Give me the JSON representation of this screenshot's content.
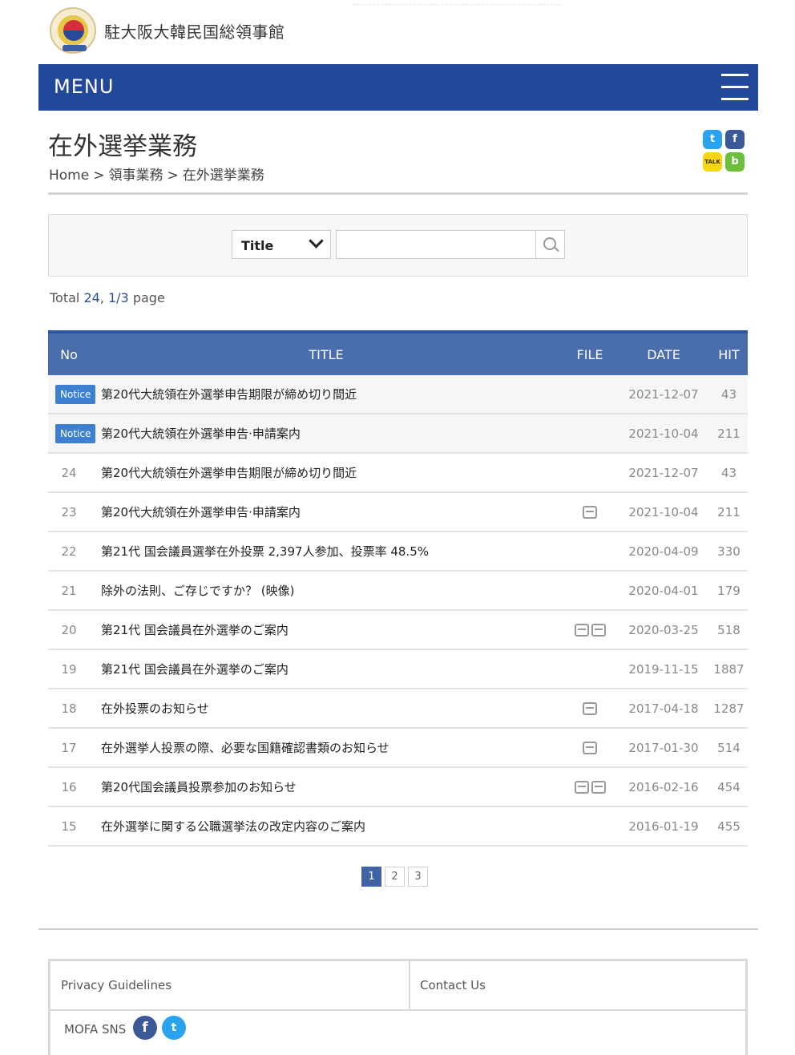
{
  "site": {
    "name": "駐大阪大韓民国総領事館"
  },
  "menu": {
    "label": "MENU"
  },
  "page": {
    "title": "在外選挙業務",
    "breadcrumb": [
      "Home",
      ">",
      "領事業務",
      ">",
      "在外選挙業務"
    ]
  },
  "search": {
    "select_value": "Title",
    "placeholder": ""
  },
  "summary": {
    "prefix": "Total ",
    "total": "24",
    "sep": ", ",
    "pages": "1/3",
    "suffix": " page"
  },
  "table": {
    "headers": {
      "no": "No",
      "title": "TITLE",
      "file": "FILE",
      "date": "DATE",
      "hit": "HIT"
    },
    "rows": [
      {
        "no": "Notice",
        "title": "第20代大統領在外選挙申告期限が締め切り間近",
        "files": 0,
        "date": "2021-12-07",
        "hit": "43",
        "notice": true
      },
      {
        "no": "Notice",
        "title": "第20代大統領在外選挙申告·申請案内",
        "files": 0,
        "date": "2021-10-04",
        "hit": "211",
        "notice": true
      },
      {
        "no": "24",
        "title": "第20代大統領在外選挙申告期限が締め切り間近",
        "files": 0,
        "date": "2021-12-07",
        "hit": "43"
      },
      {
        "no": "23",
        "title": "第20代大統領在外選挙申告·申請案内",
        "files": 1,
        "date": "2021-10-04",
        "hit": "211"
      },
      {
        "no": "22",
        "title": "第21代 国会議員選挙在外投票 2,397人参加、投票率 48.5%",
        "files": 0,
        "date": "2020-04-09",
        "hit": "330"
      },
      {
        "no": "21",
        "title": "除外の法則、ご存じですか？ (映像)",
        "files": 0,
        "date": "2020-04-01",
        "hit": "179"
      },
      {
        "no": "20",
        "title": "第21代 国会議員在外選挙のご案内",
        "files": 2,
        "date": "2020-03-25",
        "hit": "518"
      },
      {
        "no": "19",
        "title": "第21代 国会議員在外選挙のご案内",
        "files": 0,
        "date": "2019-11-15",
        "hit": "1887"
      },
      {
        "no": "18",
        "title": "在外投票のお知らせ",
        "files": 1,
        "date": "2017-04-18",
        "hit": "1287"
      },
      {
        "no": "17",
        "title": "在外選挙人投票の際、必要な国籍確認書類のお知らせ",
        "files": 1,
        "date": "2017-01-30",
        "hit": "514"
      },
      {
        "no": "16",
        "title": "第20代国会議員投票参加のお知らせ",
        "files": 2,
        "date": "2016-02-16",
        "hit": "454"
      },
      {
        "no": "15",
        "title": "在外選挙に関する公職選挙法の改定内容のご案内",
        "files": 0,
        "date": "2016-01-19",
        "hit": "455"
      }
    ]
  },
  "pagination": {
    "pages": [
      "1",
      "2",
      "3"
    ],
    "current": "1"
  },
  "footer": {
    "privacy": "Privacy Guidelines",
    "contact": "Contact Us",
    "sns_label": "MOFA SNS"
  },
  "colors": {
    "menu_bg": "#22489a",
    "table_head": "#4a6dac",
    "badge": "#3d7fd1",
    "active_page": "#3f63a5"
  },
  "icons": [
    "twitter-icon",
    "facebook-icon",
    "kakaotalk-icon",
    "kakaostory-icon",
    "chevron-down-icon",
    "search-icon",
    "file-icon"
  ]
}
